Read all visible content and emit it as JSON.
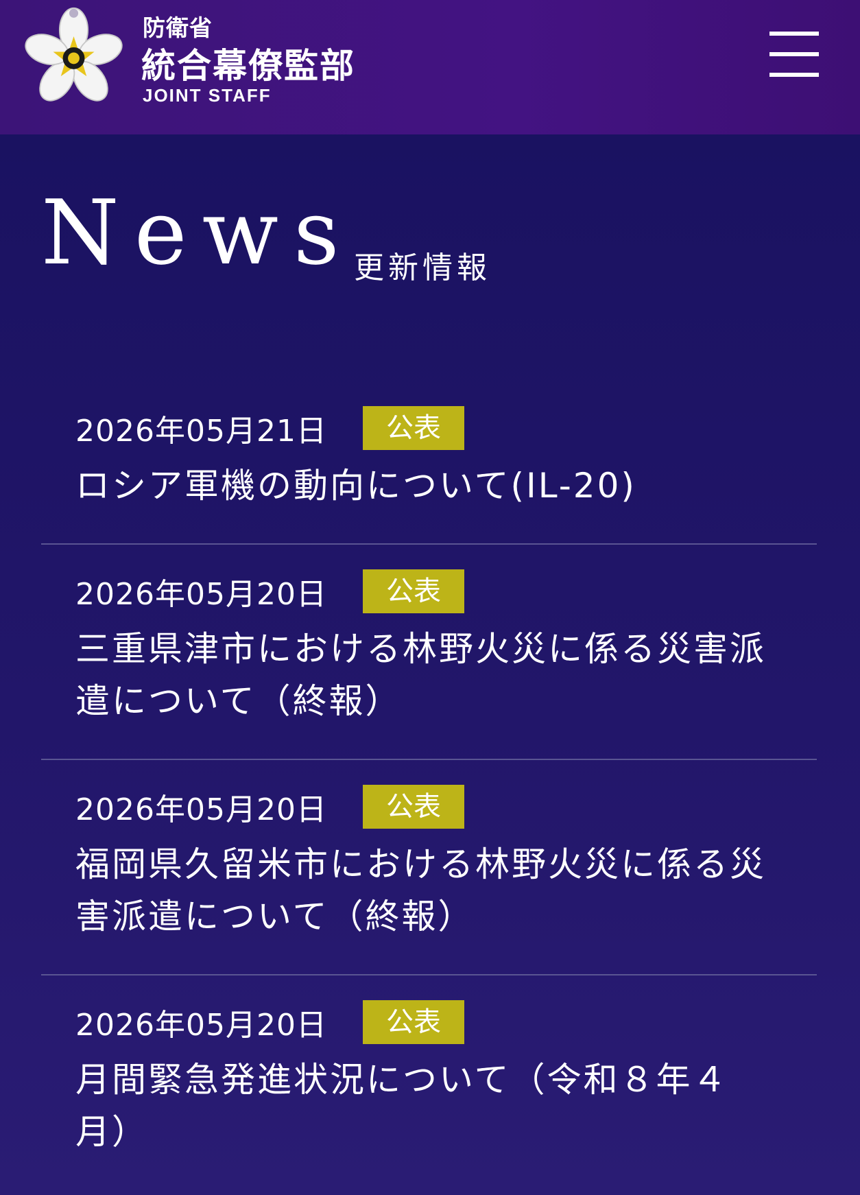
{
  "header": {
    "ministry": "防衛省",
    "org_name": "統合幕僚監部",
    "org_en": "JOINT STAFF",
    "logo_icon": "cherry-blossom-emblem-icon",
    "menu_icon": "hamburger-menu-icon"
  },
  "news": {
    "title": "News",
    "subtitle": "更新情報",
    "items": [
      {
        "date": "2026年05月21日",
        "tag": "公表",
        "title": "ロシア軍機の動向について(IL-20)"
      },
      {
        "date": "2026年05月20日",
        "tag": "公表",
        "title": "三重県津市における林野火災に係る災害派遣について（終報）"
      },
      {
        "date": "2026年05月20日",
        "tag": "公表",
        "title": "福岡県久留米市における林野火災に係る災害派遣について（終報）"
      },
      {
        "date": "2026年05月20日",
        "tag": "公表",
        "title": "月間緊急発進状況について（令和８年４月）"
      }
    ]
  },
  "colors": {
    "header_bg": "#431382",
    "page_bg": "#1c1463",
    "badge_bg": "#bdb418",
    "divider": "#5a5592"
  }
}
